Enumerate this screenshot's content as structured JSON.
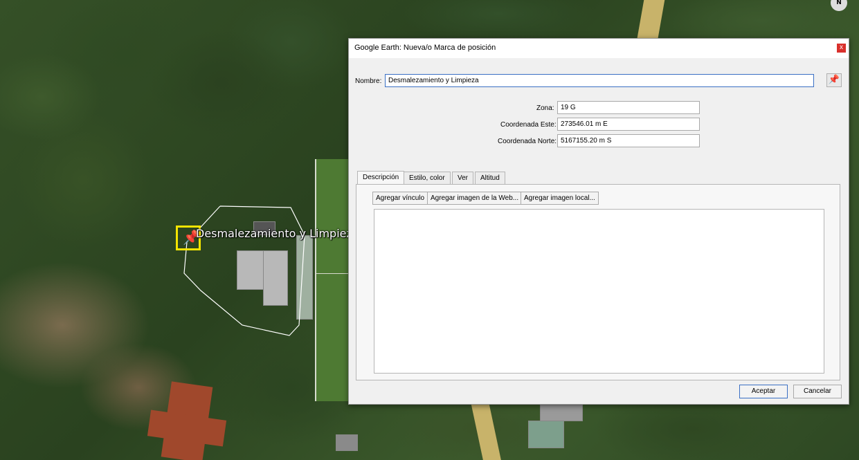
{
  "map": {
    "placemark_label": "Desmalezamiento y Limpieza",
    "compass_label": "N",
    "pin_icon": "pushpin-icon",
    "accent_color": "#f5e400"
  },
  "dialog": {
    "title": "Google Earth: Nueva/o Marca de posición",
    "close_label": "x",
    "name_label": "Nombre:",
    "name_value": "Desmalezamiento y Limpieza",
    "zone_label": "Zona:",
    "zone_value": "19 G",
    "east_label": "Coordenada Este:",
    "east_value": "273546.01 m E",
    "north_label": "Coordenada Norte:",
    "north_value": "5167155.20 m S",
    "tabs": [
      {
        "label": "Descripción"
      },
      {
        "label": "Estilo, color"
      },
      {
        "label": "Ver"
      },
      {
        "label": "Altitud"
      }
    ],
    "desc_buttons": {
      "add_link": "Agregar vínculo",
      "add_web_image": "Agregar imagen de la Web...",
      "add_local_image": "Agregar imagen local..."
    },
    "description_value": "",
    "accept_label": "Aceptar",
    "cancel_label": "Cancelar"
  }
}
